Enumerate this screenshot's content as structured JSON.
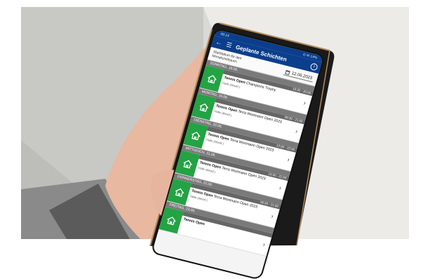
{
  "status": {
    "time": "09:14",
    "right": "⊙ ✉ 14%"
  },
  "appbar": {
    "title": "Geplante Schichten",
    "info_label": "i"
  },
  "filter": {
    "label": "Startdatum für den Monatszeitraum:",
    "date": "12.06.2023"
  },
  "days": [
    {
      "header": "SONNTAG, 18.06.",
      "time": "10:30 - 20:00",
      "event_bold": "Tennis Open",
      "event_rest": "Champions Trophy",
      "location": "Halle (Westf.)"
    },
    {
      "header": "MONTAG, 19.06.",
      "time": "09:30 - 21:00",
      "event_bold": "Tennis Open",
      "event_rest": "Terra Wortmann Open 2023",
      "location": "Halle (Westf.)"
    },
    {
      "header": "DIENSTAG, 20.06.",
      "time": "12:00 - 22:00",
      "event_bold": "Tennis Open",
      "event_rest": "Terra Wortmann Open 2023",
      "location": "Halle (Westf.)"
    },
    {
      "header": "MITTWOCH, 21.06.",
      "time": "10:30 - 21:00",
      "event_bold": "Tennis Open",
      "event_rest": "Terra Wortmann Open 2023",
      "location": "Halle (Westf.)"
    },
    {
      "header": "DONNERSTAG, 22.06.",
      "time": "09:30 - 21:00",
      "event_bold": "Tennis Open",
      "event_rest": "Terra Wortmann Open 2023",
      "location": "Halle (Westf.)"
    },
    {
      "header": "FREITAG, 23.06.",
      "time": "",
      "event_bold": "Tennis Open",
      "event_rest": "",
      "location": ""
    }
  ],
  "colors": {
    "appbar": "#0b3e8c",
    "accent_green": "#23a343",
    "day_header": "#7a7a7a"
  }
}
